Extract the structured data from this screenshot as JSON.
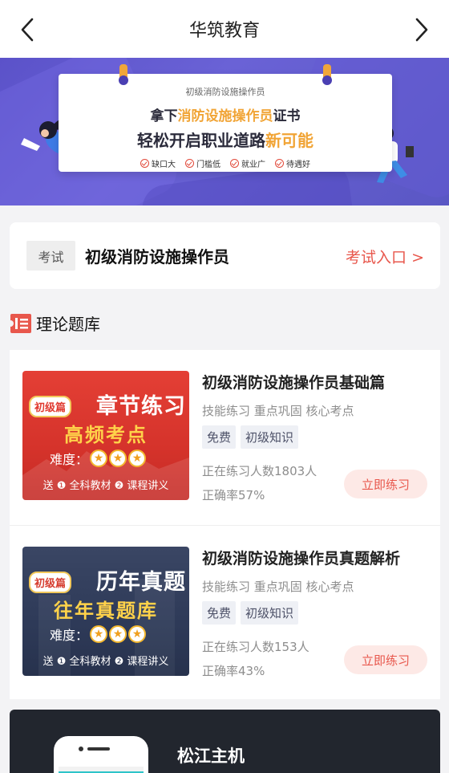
{
  "header": {
    "title": "华筑教育"
  },
  "banner": {
    "small": "初级消防设施操作员",
    "line1_pre": "拿下",
    "line1_hl": "消防设施操作员",
    "line1_post": "证书",
    "line2_pre": "轻松开启职业道路",
    "line2_hl": "新可能",
    "chips": [
      "缺口大",
      "门槛低",
      "就业广",
      "待遇好"
    ]
  },
  "exam": {
    "tag": "考试",
    "name": "初级消防设施操作员",
    "link": "考试入口 >"
  },
  "section": {
    "title": "理论题库"
  },
  "courses": [
    {
      "thumb": {
        "badge": "初级篇",
        "title1": "章节练习",
        "title2": "高频考点",
        "difficulty": "难度：",
        "gift": "送 ❶ 全科教材 ❷ 课程讲义"
      },
      "name": "初级消防设施操作员基础篇",
      "desc": "技能练习 重点巩固 核心考点",
      "tags": [
        "免费",
        "初级知识"
      ],
      "practicing": "正在练习人数1803人",
      "accuracy": "正确率57%",
      "button": "立即练习"
    },
    {
      "thumb": {
        "badge": "初级篇",
        "title1": "历年真题",
        "title2": "往年真题库",
        "difficulty": "难度：",
        "gift": "送 ❶ 全科教材 ❷ 课程讲义"
      },
      "name": "初级消防设施操作员真题解析",
      "desc": "技能练习 重点巩固 核心考点",
      "tags": [
        "免费",
        "初级知识"
      ],
      "practicing": "正在练习人数153人",
      "accuracy": "正确率43%",
      "button": "立即练习"
    }
  ],
  "promo": {
    "title": "松江主机"
  },
  "colors": {
    "accent": "#e8574c",
    "banner": "#5b52c9",
    "highlight": "#f1a435"
  },
  "icons": {
    "back": "chevron-left-icon",
    "forward": "chevron-right-icon",
    "section": "ticket-icon",
    "star": "star-icon",
    "check": "check-circle-icon"
  }
}
